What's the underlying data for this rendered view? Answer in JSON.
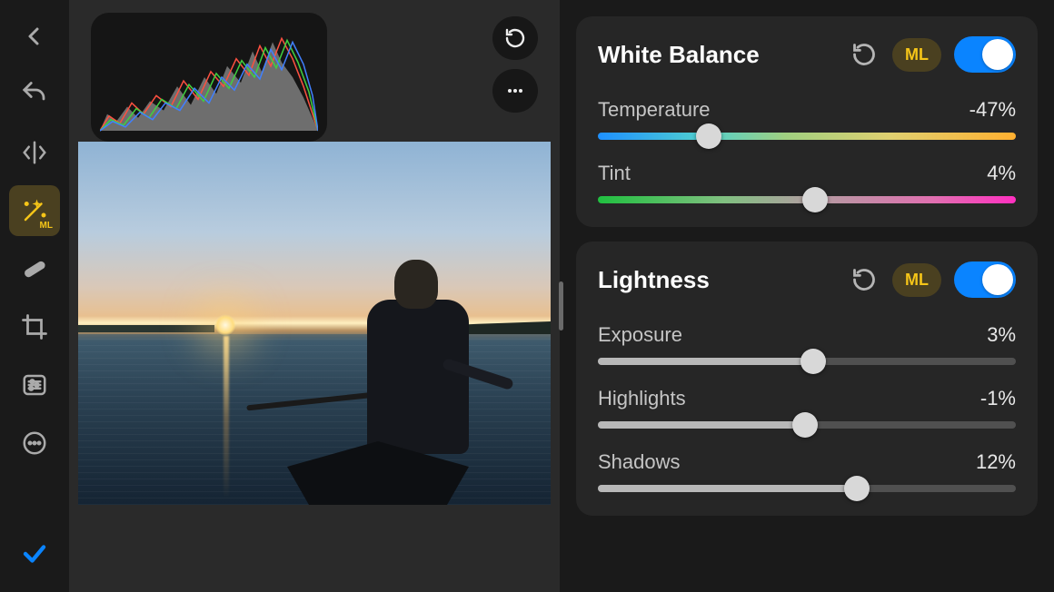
{
  "toolbar": {
    "icons": [
      "back",
      "undo",
      "compare",
      "magic-ml",
      "repair",
      "crop",
      "adjustments",
      "more",
      "done"
    ],
    "active_index": 3,
    "ml_sub": "ML"
  },
  "canvas": {
    "histogram_visible": true,
    "overlay": {
      "reset": true,
      "more": true
    }
  },
  "panel": {
    "sections": [
      {
        "id": "white-balance",
        "title": "White Balance",
        "ml_badge": "ML",
        "enabled": true,
        "controls": [
          {
            "id": "temperature",
            "label": "Temperature",
            "value_text": "-47%",
            "value_pct": 26.5,
            "track": "temp"
          },
          {
            "id": "tint",
            "label": "Tint",
            "value_text": "4%",
            "value_pct": 52,
            "track": "tint"
          }
        ]
      },
      {
        "id": "lightness",
        "title": "Lightness",
        "ml_badge": "ML",
        "enabled": true,
        "controls": [
          {
            "id": "exposure",
            "label": "Exposure",
            "value_text": "3%",
            "value_pct": 51.5,
            "track": "gray"
          },
          {
            "id": "highlights",
            "label": "Highlights",
            "value_text": "-1%",
            "value_pct": 49.5,
            "track": "gray"
          },
          {
            "id": "shadows",
            "label": "Shadows",
            "value_text": "12%",
            "value_pct": 62,
            "track": "gray"
          }
        ]
      }
    ]
  }
}
